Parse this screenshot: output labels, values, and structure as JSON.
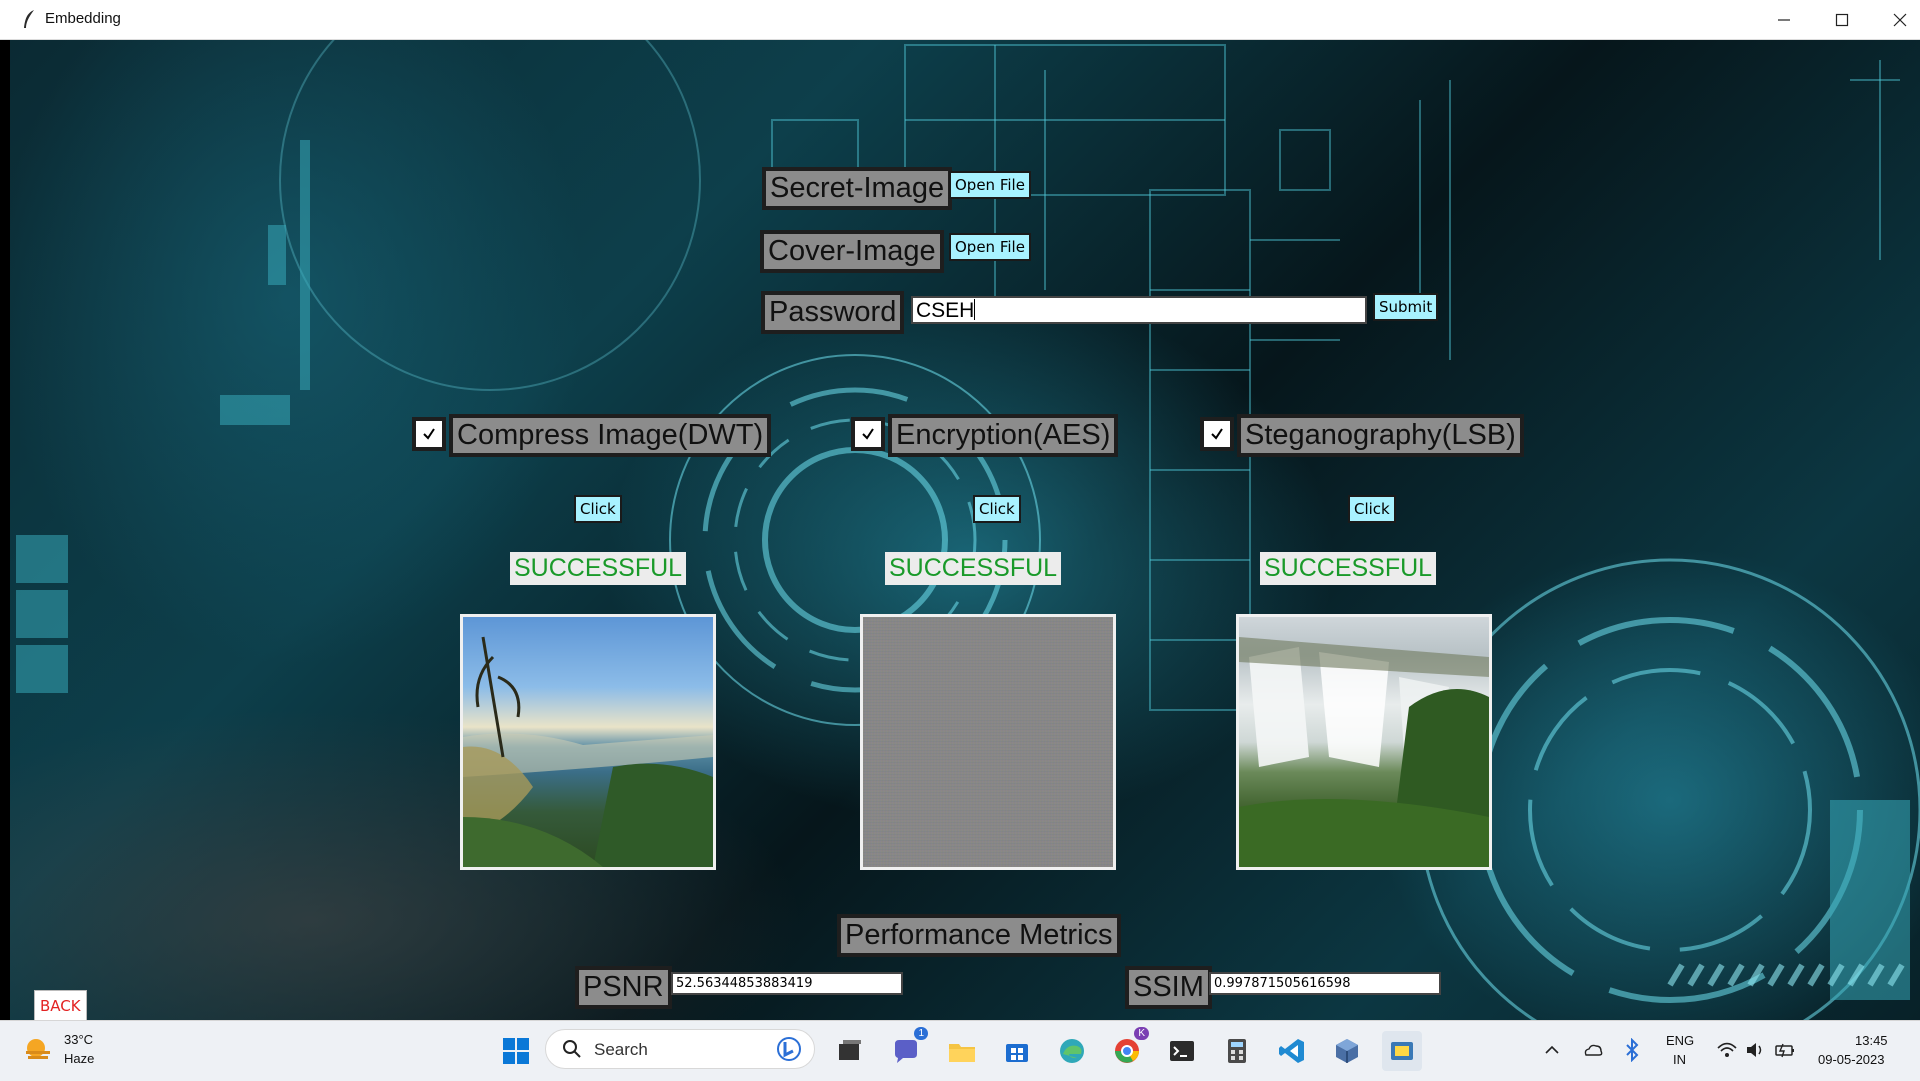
{
  "window": {
    "title": "Embedding"
  },
  "form": {
    "secret_label": "Secret-Image",
    "secret_button": "Open File",
    "cover_label": "Cover-Image",
    "cover_button": "Open File",
    "password_label": "Password",
    "password_value": "CSEH",
    "submit_button": "Submit"
  },
  "steps": [
    {
      "label": "Compress Image(DWT)",
      "checked": true,
      "button": "Click",
      "status": "SUCCESSFUL",
      "image": "coastal-landscape"
    },
    {
      "label": "Encryption(AES)",
      "checked": true,
      "button": "Click",
      "status": "SUCCESSFUL",
      "image": "noise"
    },
    {
      "label": "Steganography(LSB)",
      "checked": true,
      "button": "Click",
      "status": "SUCCESSFUL",
      "image": "waterfall"
    }
  ],
  "metrics": {
    "title": "Performance Metrics",
    "psnr_label": "PSNR",
    "psnr_value": "52.56344853883419",
    "ssim_label": "SSIM",
    "ssim_value": "0.997871505616598"
  },
  "back_button": "BACK",
  "taskbar": {
    "weather_temp": "33°C",
    "weather_desc": "Haze",
    "search_placeholder": "Search",
    "lang_top": "ENG",
    "lang_bottom": "IN",
    "time": "13:45",
    "date": "09-05-2023",
    "teams_badge": "1",
    "chrome_badge": "K"
  },
  "colors": {
    "label_bg": "#8c8c8c",
    "button_bg": "#a8f2ff",
    "success_text": "#1a9a2a",
    "back_text": "#e32222"
  }
}
